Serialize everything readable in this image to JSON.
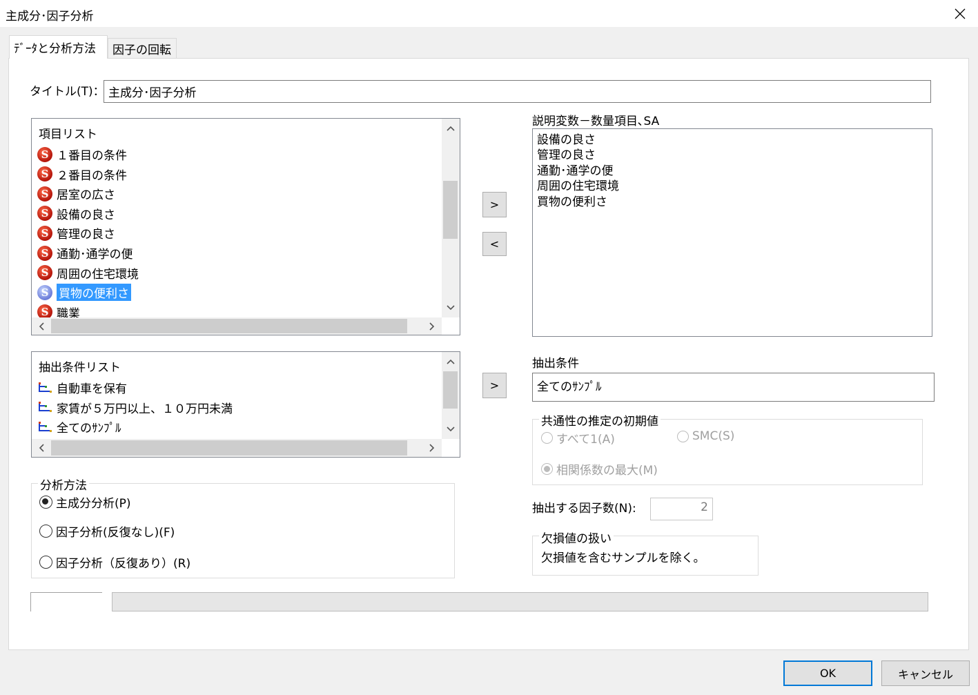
{
  "window": {
    "title": "主成分･因子分析"
  },
  "tabs": [
    {
      "label": "ﾃﾞｰﾀと分析方法"
    },
    {
      "label": "因子の回転"
    }
  ],
  "title_field": {
    "label": "タイトル(T)：",
    "value": "主成分･因子分析"
  },
  "item_list": {
    "header": "項目リスト",
    "items": [
      {
        "label": "１番目の条件"
      },
      {
        "label": "２番目の条件"
      },
      {
        "label": "居室の広さ"
      },
      {
        "label": "設備の良さ"
      },
      {
        "label": "管理の良さ"
      },
      {
        "label": "通勤･通学の便"
      },
      {
        "label": "周囲の住宅環境"
      },
      {
        "label": "買物の便利さ"
      },
      {
        "label": "職業"
      }
    ],
    "selected_index": 7,
    "icon_glyph": "S"
  },
  "explanatory": {
    "label": "説明変数－数量項目､SA",
    "items": [
      {
        "label": "設備の良さ"
      },
      {
        "label": "管理の良さ"
      },
      {
        "label": "通勤･通学の便"
      },
      {
        "label": "周囲の住宅環境"
      },
      {
        "label": "買物の便利さ"
      }
    ]
  },
  "buttons": {
    "add": ">",
    "remove": "<",
    "add_condition": ">",
    "ok": "OK",
    "cancel": "キャンセル"
  },
  "condition_list": {
    "header": "抽出条件リスト",
    "items": [
      {
        "label": "自動車を保有"
      },
      {
        "label": "家賃が５万円以上、１０万円未満"
      },
      {
        "label": "全てのｻﾝﾌﾟﾙ"
      }
    ]
  },
  "extraction_condition": {
    "label": "抽出条件",
    "value": "全てのｻﾝﾌﾟﾙ"
  },
  "communality": {
    "title": "共通性の推定の初期値",
    "options": [
      {
        "label": "すべて1(A)",
        "checked": false
      },
      {
        "label": "SMC(S)",
        "checked": false
      },
      {
        "label": "相関係数の最大(M)",
        "checked": true
      }
    ]
  },
  "method": {
    "title": "分析方法",
    "options": [
      {
        "label": "主成分分析(P)",
        "checked": true
      },
      {
        "label": "因子分析(反復なし)(F)",
        "checked": false
      },
      {
        "label": "因子分析（反復あり）(R)",
        "checked": false
      }
    ]
  },
  "factor_count": {
    "label": "抽出する因子数(N):",
    "value": "2"
  },
  "missing": {
    "title": "欠損値の扱い",
    "value": "欠損値を含むサンプルを除く。"
  }
}
